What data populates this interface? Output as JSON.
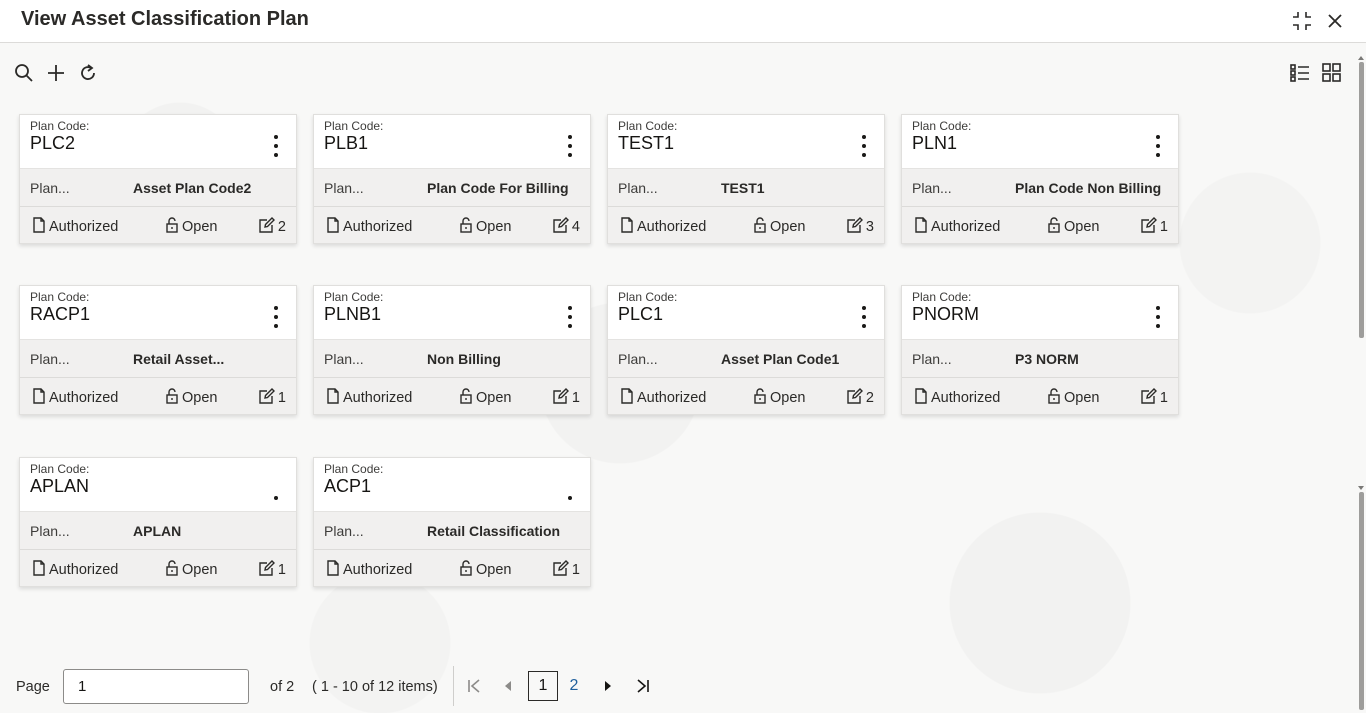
{
  "header": {
    "title": "View Asset Classification Plan",
    "icons": [
      "minimize-icon",
      "close-icon"
    ]
  },
  "toolbar": {
    "left_icons": [
      "search-icon",
      "add-icon",
      "refresh-icon"
    ],
    "right_icons": [
      "list-view-icon",
      "grid-view-icon"
    ]
  },
  "cards": [
    {
      "code_label": "Plan Code:",
      "code": "PLC2",
      "desc_label": "Plan...",
      "desc": "Asset Plan Code2",
      "status": "Authorized",
      "lock": "Open",
      "count": "2"
    },
    {
      "code_label": "Plan Code:",
      "code": "PLB1",
      "desc_label": "Plan...",
      "desc": "Plan Code For Billing",
      "status": "Authorized",
      "lock": "Open",
      "count": "4"
    },
    {
      "code_label": "Plan Code:",
      "code": "TEST1",
      "desc_label": "Plan...",
      "desc": "TEST1",
      "status": "Authorized",
      "lock": "Open",
      "count": "3"
    },
    {
      "code_label": "Plan Code:",
      "code": "PLN1",
      "desc_label": "Plan...",
      "desc": "Plan Code Non Billing",
      "status": "Authorized",
      "lock": "Open",
      "count": "1"
    },
    {
      "code_label": "Plan Code:",
      "code": "RACP1",
      "desc_label": "Plan...",
      "desc": "Retail Asset...",
      "status": "Authorized",
      "lock": "Open",
      "count": "1"
    },
    {
      "code_label": "Plan Code:",
      "code": "PLNB1",
      "desc_label": "Plan...",
      "desc": "Non Billing",
      "status": "Authorized",
      "lock": "Open",
      "count": "1"
    },
    {
      "code_label": "Plan Code:",
      "code": "PLC1",
      "desc_label": "Plan...",
      "desc": "Asset Plan Code1",
      "status": "Authorized",
      "lock": "Open",
      "count": "2"
    },
    {
      "code_label": "Plan Code:",
      "code": "PNORM",
      "desc_label": "Plan...",
      "desc": "P3 NORM",
      "status": "Authorized",
      "lock": "Open",
      "count": "1"
    },
    {
      "code_label": "Plan Code:",
      "code": "APLAN",
      "desc_label": "Plan...",
      "desc": "APLAN",
      "status": "Authorized",
      "lock": "Open",
      "count": "1"
    },
    {
      "code_label": "Plan Code:",
      "code": "ACP1",
      "desc_label": "Plan...",
      "desc": "Retail Classification",
      "status": "Authorized",
      "lock": "Open",
      "count": "1"
    }
  ],
  "pagination": {
    "page_label": "Page",
    "page_value": "1",
    "of_label": "of 2",
    "range_label": "( 1 - 10 of 12 items)",
    "pages": [
      "1",
      "2"
    ],
    "current_page": "1"
  }
}
